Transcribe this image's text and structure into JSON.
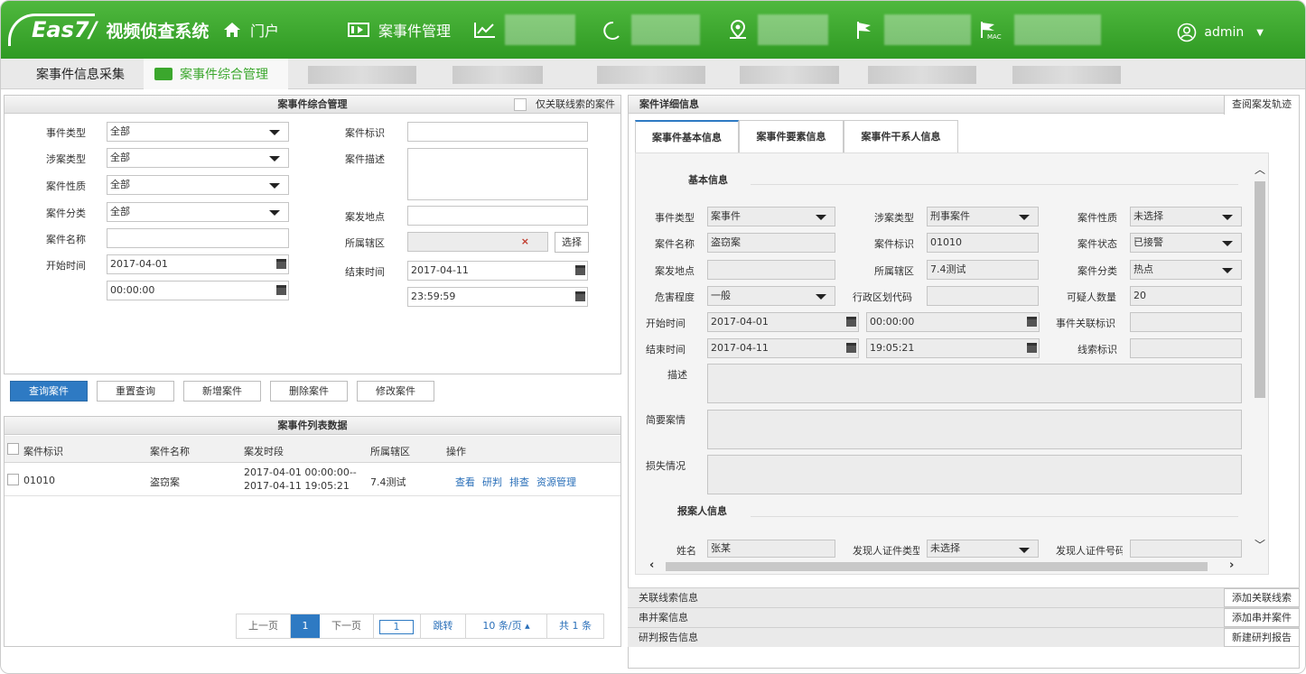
{
  "app": {
    "brand": "Eas7/",
    "system_name": "视频侦查系统",
    "user": "admin"
  },
  "topnav": [
    {
      "label": "门户",
      "icon": "home-icon"
    },
    {
      "label": "案事件管理",
      "icon": "film-icon"
    },
    {
      "label": "",
      "icon": "line-chart-icon"
    },
    {
      "label": "",
      "icon": "phone-icon"
    },
    {
      "label": "",
      "icon": "map-pin-icon"
    },
    {
      "label": "",
      "icon": "flag-icon"
    },
    {
      "label": "",
      "icon": "mac-icon"
    }
  ],
  "subnav": {
    "tab1": "案事件信息采集",
    "tab2": "案事件综合管理"
  },
  "search": {
    "title": "案事件综合管理",
    "only_linked": "仅关联线索的案件",
    "labels": {
      "event_type": "事件类型",
      "case_type": "涉案类型",
      "case_nature": "案件性质",
      "case_category": "案件分类",
      "case_name": "案件名称",
      "start_time": "开始时间",
      "case_id": "案件标识",
      "case_desc": "案件描述",
      "location": "案发地点",
      "district": "所属辖区",
      "end_time": "结束时间"
    },
    "values": {
      "event_type": "全部",
      "case_type": "全部",
      "case_nature": "全部",
      "case_category": "全部",
      "start_date": "2017-04-01",
      "start_clock": "00:00:00",
      "end_date": "2017-04-11",
      "end_clock": "23:59:59"
    },
    "select_btn": "选择"
  },
  "actions": {
    "query": "查询案件",
    "reset": "重置查询",
    "add": "新增案件",
    "delete": "删除案件",
    "modify": "修改案件"
  },
  "list": {
    "title": "案事件列表数据",
    "headers": [
      "案件标识",
      "案件名称",
      "案发时段",
      "所属辖区",
      "操作"
    ],
    "rows": [
      {
        "id": "01010",
        "name": "盗窃案",
        "period1": "2017-04-01 00:00:00--",
        "period2": "2017-04-11 19:05:21",
        "district": "7.4测试",
        "ops": [
          "查看",
          "研判",
          "排查",
          "资源管理"
        ]
      }
    ],
    "pager": {
      "prev": "上一页",
      "page": "1",
      "next": "下一页",
      "goto_value": "1",
      "goto": "跳转",
      "per_page": "10 条/页 ▴",
      "total": "共 1 条"
    }
  },
  "detail": {
    "title": "案件详细信息",
    "track_btn": "查阅案发轨迹",
    "tabs": [
      "案事件基本信息",
      "案事件要素信息",
      "案事件干系人信息"
    ],
    "basic_section": "基本信息",
    "reporter_section": "报案人信息",
    "labels": {
      "event_type": "事件类型",
      "case_type": "涉案类型",
      "case_nature": "案件性质",
      "case_name": "案件名称",
      "case_id": "案件标识",
      "case_status": "案件状态",
      "location": "案发地点",
      "district": "所属辖区",
      "case_category": "案件分类",
      "harm": "危害程度",
      "admin_code": "行政区划代码",
      "suspects": "可疑人数量",
      "start_time": "开始时间",
      "event_link": "事件关联标识",
      "end_time": "结束时间",
      "clue_id": "线索标识",
      "desc": "描述",
      "summary": "简要案情",
      "loss": "损失情况",
      "name": "姓名",
      "finder_id_type": "发现人证件类型",
      "finder_id_no": "发现人证件号码"
    },
    "values": {
      "event_type": "案事件",
      "case_type": "刑事案件",
      "case_nature": "未选择",
      "case_name": "盗窃案",
      "case_id": "01010",
      "case_status": "已接警",
      "district": "7.4测试",
      "case_category": "热点",
      "harm": "一般",
      "suspects": "20",
      "start_date": "2017-04-01",
      "start_clock": "00:00:00",
      "end_date": "2017-04-11",
      "end_clock": "19:05:21",
      "name": "张某",
      "finder_id_type": "未选择"
    }
  },
  "bottom": [
    {
      "label": "关联线索信息",
      "btn": "添加关联线索"
    },
    {
      "label": "串并案信息",
      "btn": "添加串并案件"
    },
    {
      "label": "研判报告信息",
      "btn": "新建研判报告"
    }
  ]
}
